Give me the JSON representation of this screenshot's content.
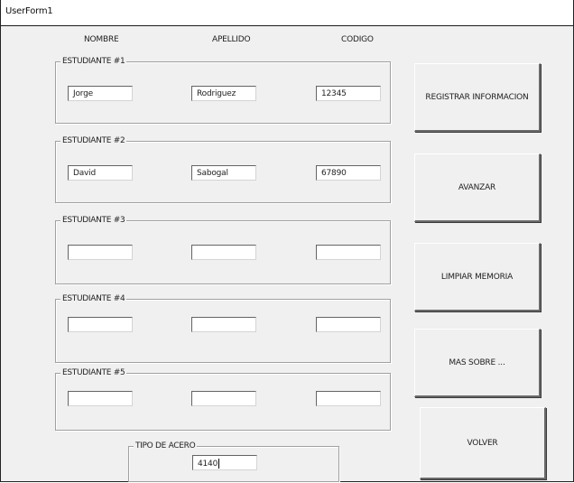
{
  "window": {
    "title": "UserForm1"
  },
  "columns": {
    "nombre": "NOMBRE",
    "apellido": "APELLIDO",
    "codigo": "CODIGO"
  },
  "students": [
    {
      "label": "ESTUDIANTE #1",
      "nombre": "Jorge",
      "apellido": "Rodriguez",
      "codigo": "12345"
    },
    {
      "label": "ESTUDIANTE #2",
      "nombre": "David",
      "apellido": "Sabogal",
      "codigo": "67890"
    },
    {
      "label": "ESTUDIANTE #3",
      "nombre": "",
      "apellido": "",
      "codigo": ""
    },
    {
      "label": "ESTUDIANTE #4",
      "nombre": "",
      "apellido": "",
      "codigo": ""
    },
    {
      "label": "ESTUDIANTE #5",
      "nombre": "",
      "apellido": "",
      "codigo": ""
    }
  ],
  "acero": {
    "label": "TIPO DE ACERO",
    "value": "4140"
  },
  "buttons": {
    "registrar": "REGISTRAR INFORMACION",
    "avanzar": "AVANZAR",
    "limpiar": "LIMPIAR MEMORIA",
    "mas_sobre": "MAS SOBRE ...",
    "volver": "VOLVER"
  }
}
